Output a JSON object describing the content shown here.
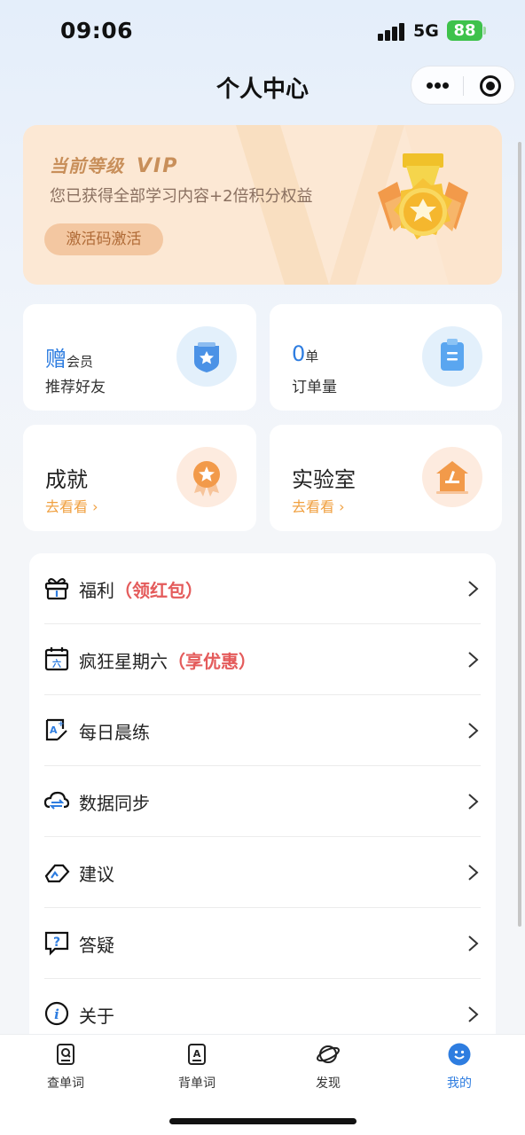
{
  "status_bar": {
    "time": "09:06",
    "network": "5G",
    "battery": "88"
  },
  "header": {
    "title": "个人中心"
  },
  "vip": {
    "title": "当前等级",
    "badge": "VIP",
    "desc": "您已获得全部学习内容+2倍积分权益",
    "activate_label": "激活码激活"
  },
  "cards": {
    "referral": {
      "big": "赠",
      "small": "会员",
      "sub": "推荐好友",
      "icon": "shield-star-icon"
    },
    "orders": {
      "big": "0",
      "small": "单",
      "sub": "订单量",
      "icon": "clipboard-icon"
    },
    "achievement": {
      "name": "成就",
      "link": "去看看 ›",
      "icon": "award-ribbon-icon"
    },
    "lab": {
      "name": "实验室",
      "link": "去看看 ›",
      "icon": "house-microscope-icon"
    }
  },
  "menu": [
    {
      "label": "福利",
      "tag": "（领红包）",
      "icon": "gift-icon"
    },
    {
      "label": "疯狂星期六",
      "tag": "（享优惠）",
      "icon": "calendar-icon"
    },
    {
      "label": "每日晨练",
      "tag": "",
      "icon": "practice-icon"
    },
    {
      "label": "数据同步",
      "tag": "",
      "icon": "cloud-sync-icon"
    },
    {
      "label": "建议",
      "tag": "",
      "icon": "feedback-icon"
    },
    {
      "label": "答疑",
      "tag": "",
      "icon": "question-icon"
    },
    {
      "label": "关于",
      "tag": "",
      "icon": "info-icon"
    }
  ],
  "tabs": [
    {
      "label": "查单词",
      "icon": "search-word-icon"
    },
    {
      "label": "背单词",
      "icon": "memorize-word-icon"
    },
    {
      "label": "发现",
      "icon": "planet-icon"
    },
    {
      "label": "我的",
      "icon": "profile-icon"
    }
  ],
  "colors": {
    "accent": "#2e7de0",
    "tag_red": "#e45b5b",
    "vip_bg": "#fce8d4",
    "link_orange": "#f0a040"
  }
}
